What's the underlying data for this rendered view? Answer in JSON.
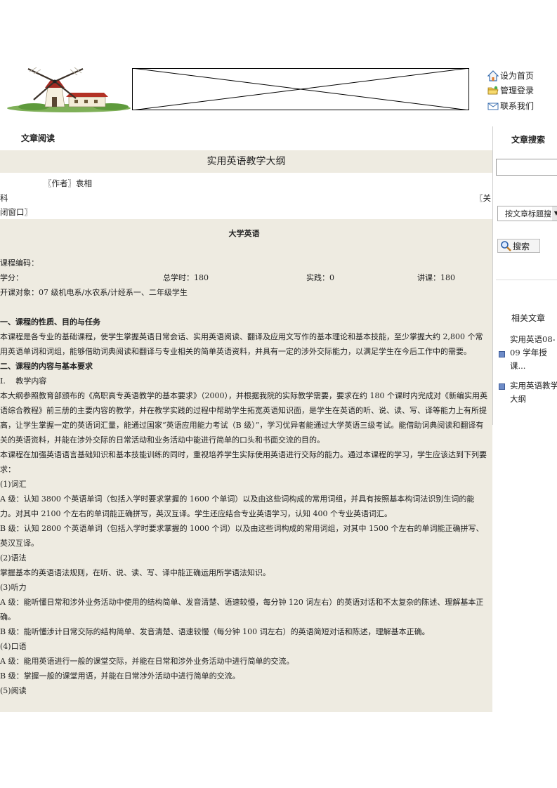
{
  "header": {
    "links": [
      {
        "label": "设为首页",
        "icon": "home-icon"
      },
      {
        "label": "管理登录",
        "icon": "folder-icon"
      },
      {
        "label": "联系我们",
        "icon": "mail-icon"
      }
    ]
  },
  "section_label": "文章阅读",
  "article": {
    "title": "实用英语教学大纲",
    "author_line": "〖作者〗袁相",
    "author_cont": "科",
    "close_a": "〖关",
    "close_b": "闭窗口〗",
    "course_title": "大学英语",
    "course_code": "课程编码：",
    "credits": "学分：",
    "total_hours": "总学时：180",
    "practice": "实践：0",
    "lecture": "讲课：180",
    "audience": "开课对象：07 级机电系/水农系/计经系一、二年级学生",
    "paragraphs": [
      {
        "text": "一、课程的性质、目的与任务",
        "bold": true,
        "gap": true
      },
      {
        "text": "本课程是各专业的基础课程，使学生掌握英语日常会话、实用英语阅读、翻译及应用文写作的基本理论和基本技能，至少掌握大约 2,800 个常用英语单词和词组，能够借助词典阅读和翻译与专业相关的简单英语资料，并具有一定的涉外交际能力，以满足学生在今后工作中的需要。"
      },
      {
        "text": "二、课程的内容与基本要求",
        "bold": true
      },
      {
        "text": "I.　 教学内容"
      },
      {
        "text": "本大纲参照教育部颁布的《高职高专英语教学的基本要求》（2000），并根据我院的实际教学需要，要求在约 180 个课时内完成对《新编实用英语综合教程》前三册的主要内容的教学，并在教学实践的过程中帮助学生拓宽英语知识面，是学生在英语的听、说、读、写、译等能力上有所提高，让学生掌握一定的英语词汇量，能通过国家“英语应用能力考试（B 级）”，学习优异者能通过大学英语三级考试。能借助词典阅读和翻译有关的英语资料，并能在涉外交际的日常活动和业务活动中能进行简单的口头和书面交流的目的。"
      },
      {
        "text": "本课程在加强英语语言基础知识和基本技能训练的同时，重视培养学生实际使用英语进行交际的能力。通过本课程的学习，学生应该达到下列要求："
      },
      {
        "text": "(1)词汇"
      },
      {
        "text": "A 级：认知 3800 个英语单词（包括入学时要求掌握的 1600 个单词）以及由这些词构成的常用词组，并具有按照基本构词法识别生词的能力。对其中 2100 个左右的单词能正确拼写，英汉互译。学生还应结合专业英语学习，认知 400 个专业英语词汇。"
      },
      {
        "text": "B 级：认知 2800 个英语单词（包括入学时要求掌握的 1000 个词）以及由这些词构成的常用词组，对其中 1500 个左右的单词能正确拼写、英汉互译。"
      },
      {
        "text": "(2)语法"
      },
      {
        "text": "掌握基本的英语语法规则，在听、说、读、写、译中能正确运用所学语法知识。"
      },
      {
        "text": "(3)听力"
      },
      {
        "text": "A 级：能听懂日常和涉外业务活动中使用的结构简单、发音清楚、语速较慢，每分钟 120 词左右）的英语对话和不太复杂的陈述、理解基本正确。"
      },
      {
        "text": "B 级：能听懂涉计日常交际的结构简单、发音清楚、语速较慢（每分钟 100 词左右）的英语简短对话和陈述，理解基本正确。"
      },
      {
        "text": "(4)口语"
      },
      {
        "text": "A 级：能用英语进行一般的课堂交际，并能在日常和涉外业务活动中进行简单的交流。"
      },
      {
        "text": "B 级：掌握一般的课堂用语，并能在日常涉外活动中进行简单的交流。"
      },
      {
        "text": "(5)阅读"
      }
    ]
  },
  "sidebar": {
    "title": "文章搜索",
    "select_value": "按文章标题搜",
    "search_button": "搜索",
    "related_title": "相关文章",
    "related": [
      {
        "label": "实用英语08-09 学年授课..."
      },
      {
        "label": "实用英语教学大纲"
      }
    ]
  },
  "colors": {
    "content_bg": "#eeebe1",
    "bullet": "#6e8cc8"
  }
}
